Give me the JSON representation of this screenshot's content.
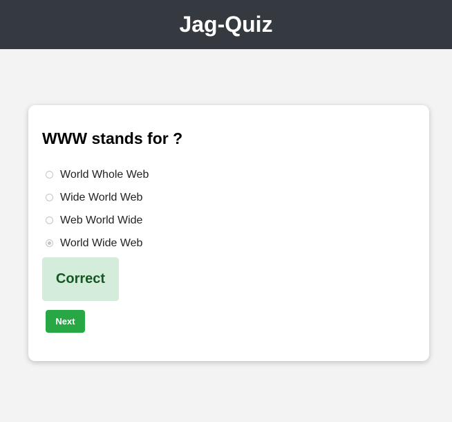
{
  "header": {
    "title": "Jag-Quiz"
  },
  "quiz": {
    "question": "WWW stands for ?",
    "options": [
      {
        "label": "World Whole Web",
        "selected": false
      },
      {
        "label": "Wide World Web",
        "selected": false
      },
      {
        "label": "Web World Wide",
        "selected": false
      },
      {
        "label": "World Wide Web",
        "selected": true
      }
    ],
    "result": "Correct",
    "next_label": "Next"
  },
  "colors": {
    "header_bg": "#343a40",
    "result_bg": "#d4edda",
    "result_text": "#155724",
    "next_bg": "#28a745"
  }
}
